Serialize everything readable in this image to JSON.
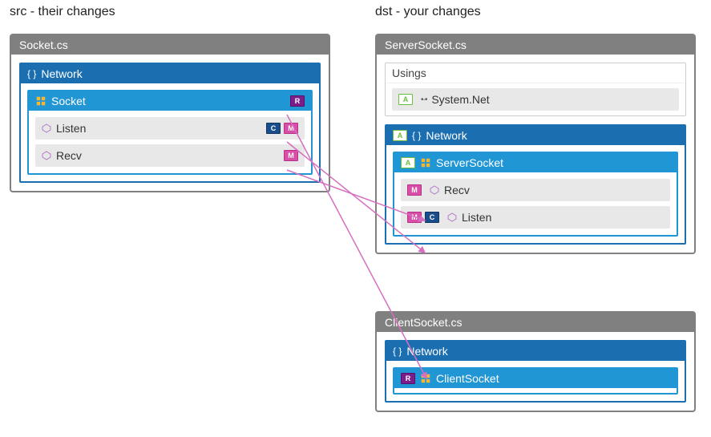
{
  "headers": {
    "src": "src - their changes",
    "dst": "dst - your changes"
  },
  "src": {
    "file": "Socket.cs",
    "namespace": "Network",
    "class": {
      "name": "Socket",
      "badges": [
        "R"
      ],
      "members": [
        {
          "name": "Listen",
          "right_badges": [
            "C",
            "M"
          ]
        },
        {
          "name": "Recv",
          "right_badges": [
            "M"
          ]
        }
      ]
    }
  },
  "dst": {
    "file1": {
      "name": "ServerSocket.cs",
      "usings_label": "Usings",
      "usings": [
        {
          "name": "System.Net",
          "left_badges": [
            "A"
          ]
        }
      ],
      "namespace": "Network",
      "ns_badges": [
        "A"
      ],
      "class": {
        "name": "ServerSocket",
        "header_badges": [
          "A"
        ],
        "members": [
          {
            "name": "Recv",
            "left_badges": [
              "M"
            ]
          },
          {
            "name": "Listen",
            "left_badges": [
              "M",
              "C"
            ]
          }
        ]
      }
    },
    "file2": {
      "name": "ClientSocket.cs",
      "namespace": "Network",
      "class": {
        "name": "ClientSocket",
        "header_badges": [
          "R"
        ]
      }
    }
  },
  "badge_labels": {
    "A": "A",
    "M": "M",
    "C": "C",
    "R": "R"
  }
}
